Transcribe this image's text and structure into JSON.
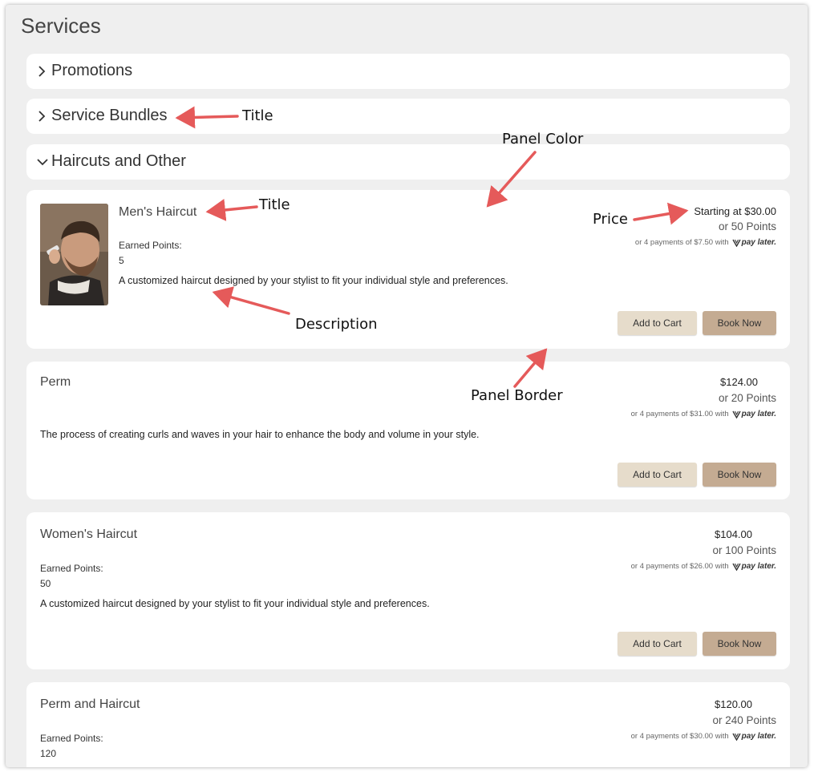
{
  "page": {
    "title": "Services"
  },
  "accordions": [
    {
      "title": "Promotions",
      "state": "collapsed"
    },
    {
      "title": "Service Bundles",
      "state": "collapsed"
    },
    {
      "title": "Haircuts and Other",
      "state": "expanded"
    }
  ],
  "services": [
    {
      "title": "Men's Haircut",
      "has_image": true,
      "earned_points_label": "Earned Points:",
      "earned_points": "5",
      "description": "A customized haircut designed by your stylist to fit your individual style and preferences.",
      "price": "Starting at $30.00",
      "points_price": "or 50 Points",
      "paylater": "or 4 payments of $7.50 with",
      "paylater_brand": "pay later.",
      "add_to_cart": "Add to Cart",
      "book_now": "Book Now"
    },
    {
      "title": "Perm",
      "has_image": false,
      "description": "The process of creating curls and waves in your hair to enhance the body and volume in your style.",
      "price": "$124.00",
      "points_price": "or 20 Points",
      "paylater": "or 4 payments of $31.00 with",
      "paylater_brand": "pay later.",
      "add_to_cart": "Add to Cart",
      "book_now": "Book Now"
    },
    {
      "title": "Women's Haircut",
      "has_image": false,
      "earned_points_label": "Earned Points:",
      "earned_points": "50",
      "description": "A customized haircut designed by your stylist to fit your individual style and preferences.",
      "price": "$104.00",
      "points_price": "or 100 Points",
      "paylater": "or 4 payments of $26.00 with",
      "paylater_brand": "pay later.",
      "add_to_cart": "Add to Cart",
      "book_now": "Book Now"
    },
    {
      "title": "Perm and Haircut",
      "has_image": false,
      "earned_points_label": "Earned Points:",
      "earned_points": "120",
      "price": "$120.00",
      "points_price": "or 240 Points",
      "paylater": "or 4 payments of $30.00 with",
      "paylater_brand": "pay later."
    }
  ],
  "annotations": {
    "title_1": "Title",
    "panel_color": "Panel Color",
    "title_2": "Title",
    "price": "Price",
    "description": "Description",
    "panel_border": "Panel Border"
  },
  "colors": {
    "background": "#efefef",
    "panel": "#ffffff",
    "add_to_cart_button": "#e6dccb",
    "book_now_button": "#c4ab92",
    "annotation_arrow": "#e55a5a"
  },
  "icons": {
    "collapsed": "chevron-right-icon",
    "expanded": "chevron-down-icon",
    "paylater": "paylater-logo-icon"
  }
}
